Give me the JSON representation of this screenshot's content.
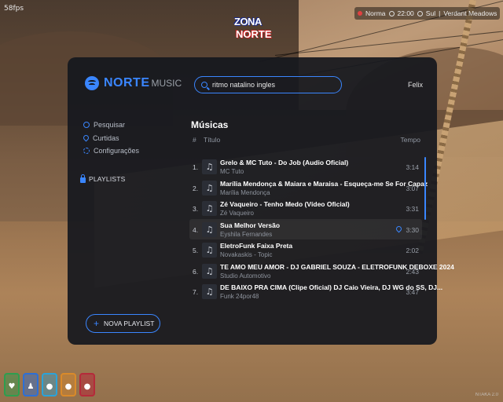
{
  "hud": {
    "fps": "58fps",
    "logo_line1": "ZONA",
    "logo_line2": "NORTE",
    "status": "Norma",
    "time": "22:00",
    "direction": "Sul",
    "location": "Verdant Meadows"
  },
  "app": {
    "brand_primary": "NORTE",
    "brand_secondary": "MUSIC",
    "search": {
      "value": "ritmo natalino ingles",
      "placeholder": ""
    },
    "user_name": "Felix",
    "nav": [
      {
        "label": "Pesquisar",
        "icon": "search-icon"
      },
      {
        "label": "Curtidas",
        "icon": "heart-icon"
      },
      {
        "label": "Configurações",
        "icon": "gear-icon"
      }
    ],
    "playlists_label": "PLAYLISTS",
    "new_playlist_label": "NOVA PLAYLIST",
    "section_title": "Músicas",
    "columns": {
      "num": "#",
      "title": "Título",
      "time": "Tempo"
    },
    "tracks": [
      {
        "num": "1.",
        "title": "Grelo & MC Tuto - Do Job (Audio Oficial)",
        "artist": "MC Tuto",
        "duration": "3:14"
      },
      {
        "num": "2.",
        "title": "Marília Mendonça & Maiara e Maraisa - Esqueça-me Se For Capaz",
        "artist": "Marília Mendonça",
        "duration": "3:07"
      },
      {
        "num": "3.",
        "title": "Zé Vaqueiro - Tenho Medo (Vídeo Oficial)",
        "artist": "Zé Vaqueiro",
        "duration": "3:31"
      },
      {
        "num": "4.",
        "title": "Sua Melhor Versão",
        "artist": "Eyshila Fernandes",
        "duration": "3:30"
      },
      {
        "num": "5.",
        "title": "EletroFunk Faixa Preta",
        "artist": "Novakaskis - Topic",
        "duration": "2:02"
      },
      {
        "num": "6.",
        "title": "TE AMO MEU AMOR - DJ GABRIEL SOUZA - ELETROFUNK DEBOXE 2024",
        "artist": "Studio Automotivo",
        "duration": "2:43"
      },
      {
        "num": "7.",
        "title": "DE BAIXO PRA CIMA (Clipe Oficial) DJ Caio Vieira, DJ WG do SS, DJ...",
        "artist": "Funk 24por48",
        "duration": "3:47"
      }
    ]
  },
  "stats": [
    {
      "icon": "heart-icon",
      "glyph": "♥",
      "color": "#2e9e4f"
    },
    {
      "icon": "shield-icon",
      "glyph": "♟",
      "color": "#2d6fd6"
    },
    {
      "icon": "drop-icon",
      "glyph": "💧",
      "color": "#2aa3d9"
    },
    {
      "icon": "food-icon",
      "glyph": "●",
      "color": "#d98a2a"
    },
    {
      "icon": "brain-icon",
      "glyph": "●",
      "color": "#b52a3a"
    }
  ],
  "watermark": "NTAKA 2.0"
}
